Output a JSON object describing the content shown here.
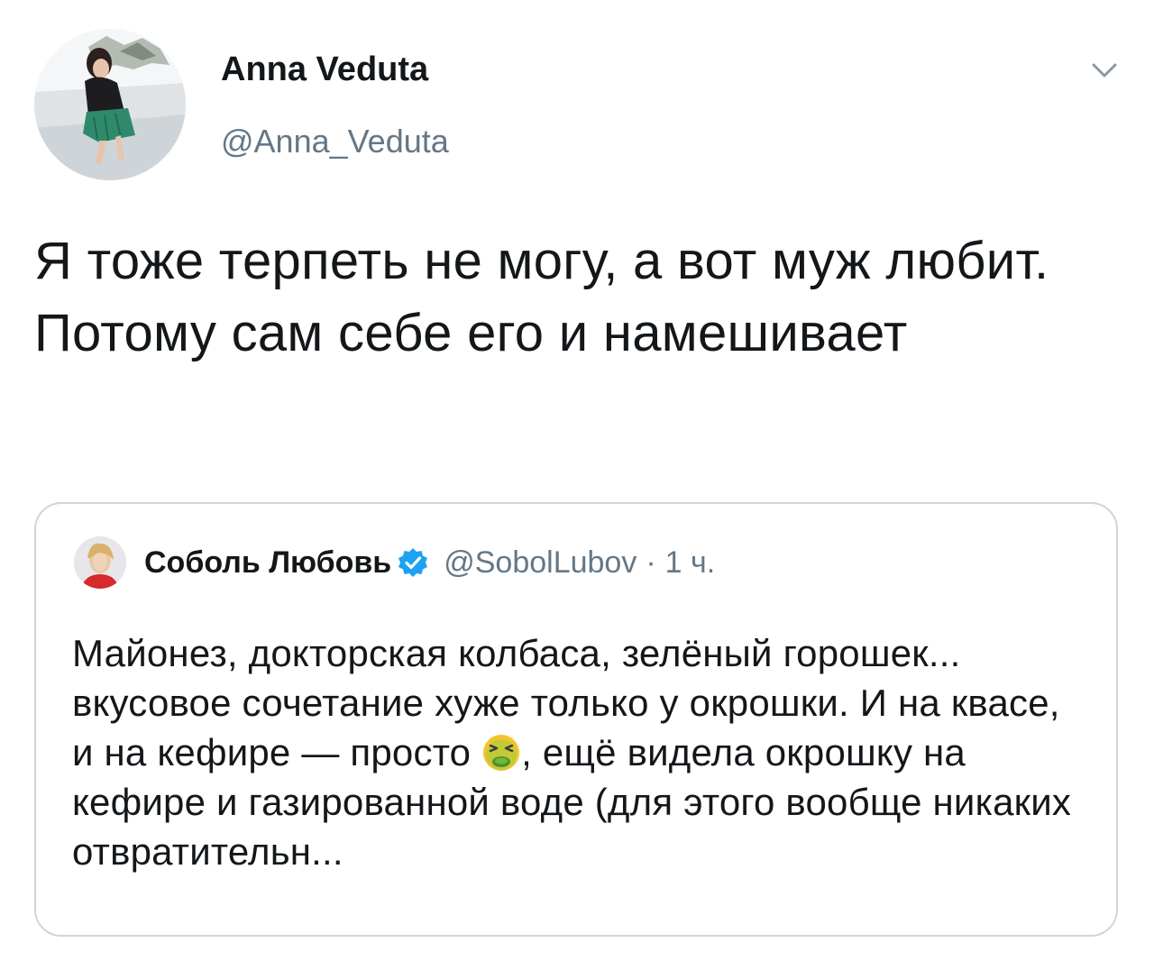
{
  "author": {
    "name": "Anna Veduta",
    "handle": "@Anna_Veduta"
  },
  "tweet": {
    "text": "Я тоже терпеть не могу, а вот муж любит. Потому сам себе его и намешивает"
  },
  "quoted": {
    "name": "Соболь Любовь",
    "handle": "@SobolLubov",
    "separator": "·",
    "time": "1 ч.",
    "text_part1": "Майонез, докторская колбаса, зелёный горошек... вкусовое сочетание хуже только у окрошки. И на квасе, и на кефире — просто ",
    "text_part2": ", ещё видела окрошку на кефире и газированной воде (для этого вообще никаких отвратительн..."
  },
  "icons": {
    "menu": "chevron-down-icon",
    "verified": "verified-badge-icon",
    "emoji": "nauseated-face-emoji"
  },
  "colors": {
    "text": "#14171a",
    "secondary": "#657786",
    "border": "#ccd6dd",
    "verified": "#1da1f2"
  }
}
